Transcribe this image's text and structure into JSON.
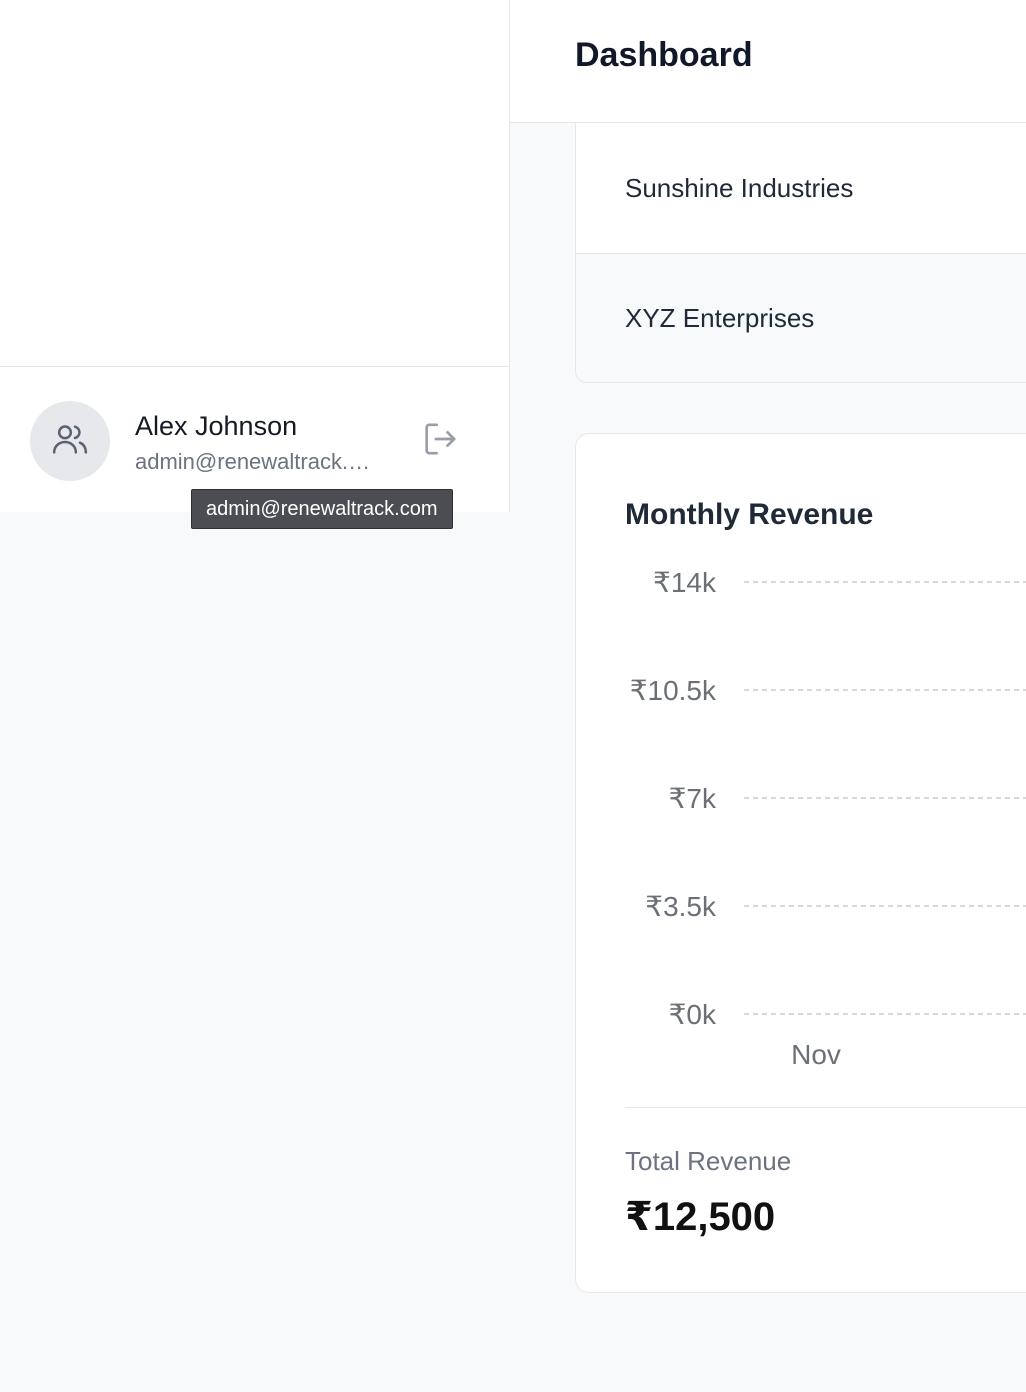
{
  "header": {
    "title": "Dashboard"
  },
  "user": {
    "name": "Alex Johnson",
    "email": "admin@renewaltrack.com",
    "avatar_icon": "users-icon",
    "logout_icon": "logout-icon"
  },
  "tooltip": {
    "text": "admin@renewaltrack.com"
  },
  "customers": {
    "rows": [
      {
        "name": "Sunshine Industries"
      },
      {
        "name": "XYZ Enterprises"
      }
    ]
  },
  "revenue": {
    "title": "Monthly Revenue",
    "total_label": "Total Revenue",
    "total_value": "₹12,500"
  },
  "chart_data": {
    "type": "bar",
    "title": "Monthly Revenue",
    "categories": [
      "Nov"
    ],
    "ylim": [
      0,
      14000
    ],
    "yticks": [
      0,
      3500,
      7000,
      10500,
      14000
    ],
    "ytick_labels": [
      "₹0k",
      "₹3.5k",
      "₹7k",
      "₹10.5k",
      "₹14k"
    ],
    "grid": true,
    "grid_style": "dashed",
    "colors": {
      "grid": "#c9ccd2",
      "tick_text": "#6b6f76"
    }
  }
}
